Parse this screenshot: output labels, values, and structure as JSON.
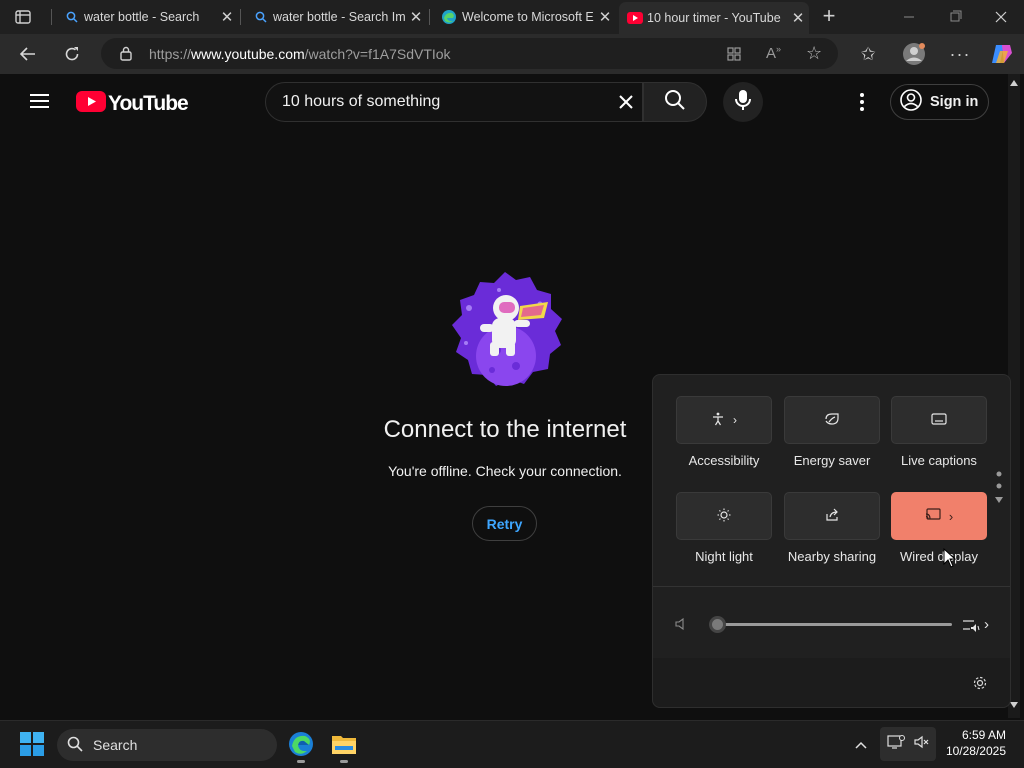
{
  "browser": {
    "tabs": [
      {
        "title": "water bottle - Search",
        "icon": "search-icon"
      },
      {
        "title": "water bottle - Search Im",
        "icon": "search-icon"
      },
      {
        "title": "Welcome to Microsoft E",
        "icon": "edge-icon"
      },
      {
        "title": "10 hour timer - YouTube",
        "icon": "youtube-icon",
        "active": true
      }
    ],
    "url_prefix": "https://",
    "url_domain": "www.youtube.com",
    "url_path": "/watch?v=f1A7SdVTIok"
  },
  "youtube": {
    "logo_text": "YouTube",
    "search_value": "10 hours of something",
    "signin_label": "Sign in",
    "offline_title": "Connect to the internet",
    "offline_sub": "You're offline. Check your connection.",
    "retry_label": "Retry"
  },
  "quick_settings": {
    "tiles": [
      {
        "label": "Accessibility",
        "icon": "accessibility-icon",
        "has_chevron": true,
        "on": false
      },
      {
        "label": "Energy saver",
        "icon": "energy-saver-icon",
        "on": false
      },
      {
        "label": "Live captions",
        "icon": "live-captions-icon",
        "on": false
      },
      {
        "label": "Night light",
        "icon": "night-light-icon",
        "on": false
      },
      {
        "label": "Nearby sharing",
        "icon": "nearby-sharing-icon",
        "on": false
      },
      {
        "label": "Wired display",
        "icon": "wired-display-icon",
        "has_chevron": true,
        "on": true
      }
    ],
    "volume_level": 0,
    "accent": "#f1806b"
  },
  "taskbar": {
    "search_label": "Search",
    "time": "6:59 AM",
    "date": "10/28/2025"
  }
}
